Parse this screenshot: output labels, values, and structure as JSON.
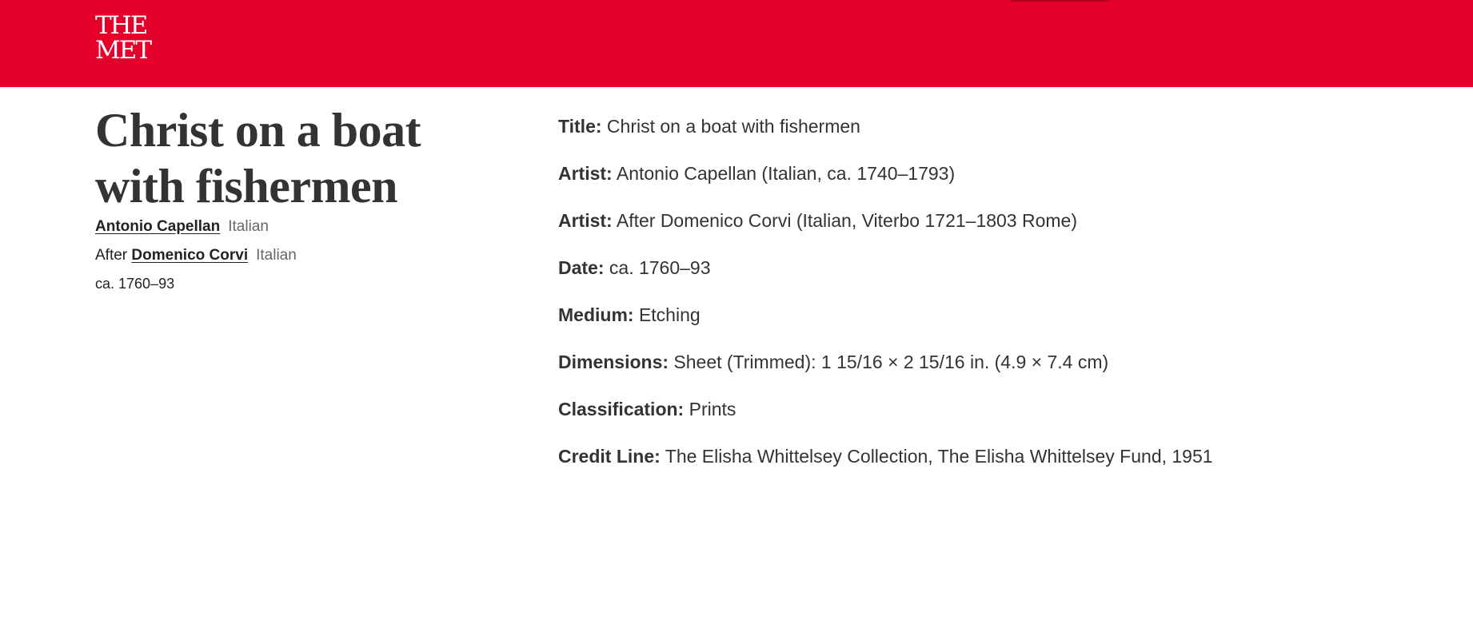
{
  "header": {
    "logo_line1": "THE",
    "logo_line2": "MET",
    "accent_color": "#e4002b"
  },
  "object": {
    "title": "Christ on a boat with fishermen",
    "makers": [
      {
        "prefix": "",
        "name": "Antonio Capellan",
        "nationality": "Italian"
      },
      {
        "prefix": "After",
        "name": "Domenico Corvi",
        "nationality": "Italian"
      }
    ],
    "date": "ca. 1760–93"
  },
  "details": [
    {
      "label": "Title:",
      "value": "Christ on a boat with fishermen"
    },
    {
      "label": "Artist:",
      "value": "Antonio Capellan (Italian, ca. 1740–1793)"
    },
    {
      "label": "Artist:",
      "value": "After Domenico Corvi (Italian, Viterbo 1721–1803 Rome)"
    },
    {
      "label": "Date:",
      "value": "ca. 1760–93"
    },
    {
      "label": "Medium:",
      "value": "Etching"
    },
    {
      "label": "Dimensions:",
      "value": "Sheet (Trimmed): 1 15/16 × 2 15/16 in. (4.9 × 7.4 cm)"
    },
    {
      "label": "Classification:",
      "value": "Prints"
    },
    {
      "label": "Credit Line:",
      "value": "The Elisha Whittelsey Collection, The Elisha Whittelsey Fund, 1951"
    }
  ]
}
